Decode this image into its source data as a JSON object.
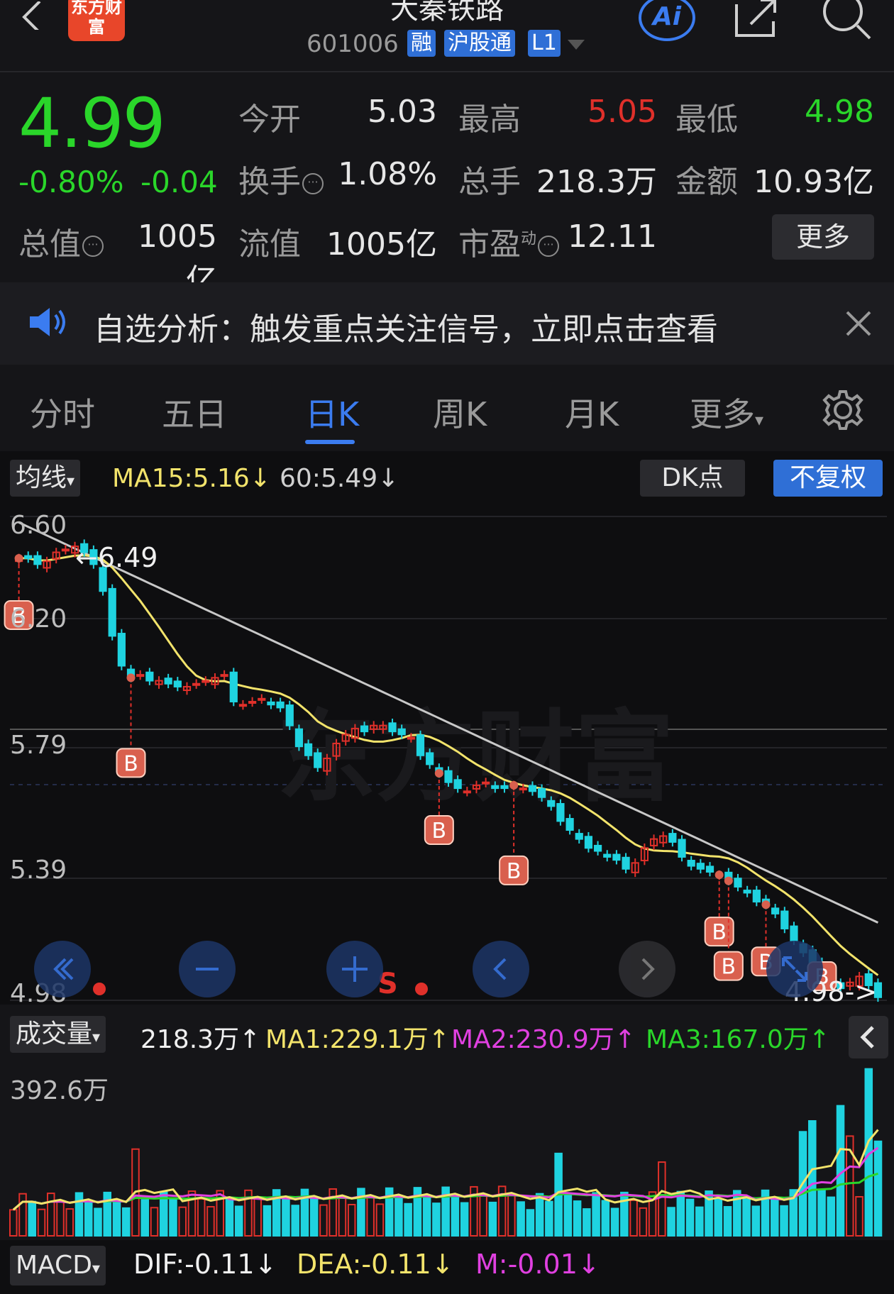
{
  "header": {
    "logo_text": "东方财富",
    "title": "大秦铁路",
    "code": "601006",
    "tags": [
      "融",
      "沪股通",
      "L1"
    ],
    "ai_label": "Ai"
  },
  "quote": {
    "price": "4.99",
    "change_pct": "-0.80%",
    "change_abs": "-0.04",
    "rows": [
      [
        {
          "label": "今开",
          "value": "5.03",
          "color": "#e6e6e6"
        },
        {
          "label": "最高",
          "value": "5.05",
          "color": "#e0302a"
        },
        {
          "label": "最低",
          "value": "4.98",
          "color": "#2ad62a"
        }
      ],
      [
        {
          "label": "换手",
          "value": "1.08%",
          "color": "#e6e6e6"
        },
        {
          "label": "总手",
          "value": "218.3万",
          "color": "#e6e6e6"
        },
        {
          "label": "金额",
          "value": "10.93亿",
          "color": "#e6e6e6"
        }
      ],
      [
        {
          "label": "总值",
          "value": "1005亿",
          "color": "#e6e6e6"
        },
        {
          "label": "流值",
          "value": "1005亿",
          "color": "#e6e6e6"
        },
        {
          "label": "市盈",
          "value": "12.11",
          "color": "#e6e6e6",
          "superscript": "动"
        }
      ]
    ],
    "more_label": "更多"
  },
  "notice": {
    "text": "自选分析：触发重点关注信号，立即点击查看"
  },
  "tabs": [
    "分时",
    "五日",
    "日K",
    "周K",
    "月K",
    "更多"
  ],
  "active_tab": "日K",
  "kline": {
    "ma_select": "均线",
    "ma15": "MA15:5.16↓",
    "ma60": "60:5.49↓",
    "dk_label": "DK点",
    "adjust_label": "不复权",
    "y_labels": [
      "6.60",
      "6.20",
      "5.79",
      "5.39",
      "4.98"
    ],
    "high_marker": "←6.49",
    "low_marker": "4.98->",
    "sell_marker": "S",
    "buy_marker": "B",
    "watermark": "东方财富"
  },
  "volume": {
    "select": "成交量",
    "current": "218.3万↑",
    "ma1": "MA1:229.1万↑",
    "ma2": "MA2:230.9万↑",
    "ma3": "MA3:167.0万↑",
    "y_top": "392.6万"
  },
  "macd": {
    "select": "MACD",
    "dif": "DIF:-0.11↓",
    "dea": "DEA:-0.11↓",
    "m": "M:-0.01↓"
  },
  "colors": {
    "up": "#e0302a",
    "down": "#1fd3e0",
    "ma15": "#f2e36b",
    "ma60": "#c8c8c8",
    "accent": "#3b7cf0",
    "green": "#2ad62a",
    "magenta": "#e040e0"
  },
  "chart_data": {
    "type": "candlestick",
    "title": "",
    "y_labels": [
      6.6,
      6.2,
      5.79,
      5.39,
      4.98
    ],
    "ylim": [
      4.98,
      6.6
    ],
    "closes": [
      6.46,
      6.46,
      6.44,
      6.45,
      6.48,
      6.49,
      6.5,
      6.48,
      6.44,
      6.35,
      6.2,
      6.1,
      6.06,
      6.07,
      6.05,
      6.05,
      6.04,
      6.03,
      6.03,
      6.04,
      6.05,
      6.06,
      6.07,
      5.98,
      5.97,
      5.98,
      5.99,
      5.97,
      5.96,
      5.9,
      5.83,
      5.8,
      5.76,
      5.79,
      5.84,
      5.87,
      5.89,
      5.88,
      5.9,
      5.9,
      5.88,
      5.87,
      5.86,
      5.8,
      5.77,
      5.74,
      5.71,
      5.69,
      5.68,
      5.7,
      5.71,
      5.69,
      5.69,
      5.7,
      5.69,
      5.68,
      5.66,
      5.63,
      5.58,
      5.55,
      5.52,
      5.49,
      5.48,
      5.46,
      5.45,
      5.42,
      5.44,
      5.49,
      5.52,
      5.53,
      5.51,
      5.46,
      5.43,
      5.42,
      5.41,
      5.4,
      5.38,
      5.36,
      5.34,
      5.31,
      5.3,
      5.27,
      5.22,
      5.18,
      5.14,
      5.1,
      5.05,
      5.03,
      5.02,
      5.04,
      5.06,
      5.03,
      4.99
    ],
    "buy_signal_indexes": [
      0,
      12,
      45,
      53,
      75,
      76,
      80,
      86
    ],
    "volume_max": 392.6
  }
}
